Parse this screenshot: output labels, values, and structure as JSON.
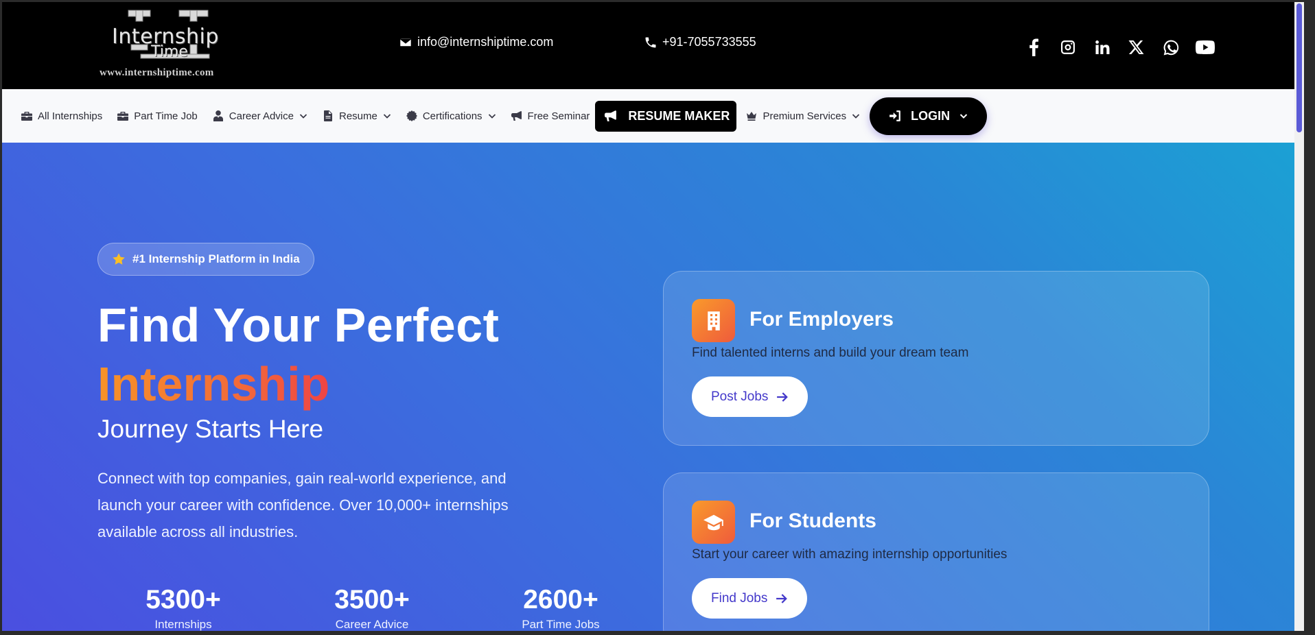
{
  "header": {
    "logo_text_1": "Internship",
    "logo_text_2": "Time",
    "logo_url": "www.internshiptime.com",
    "email": "info@internshiptime.com",
    "phone": "+91-7055733555",
    "socials": [
      "facebook-icon",
      "instagram-icon",
      "linkedin-icon",
      "x-icon",
      "whatsapp-icon",
      "youtube-icon"
    ]
  },
  "nav": {
    "items": [
      {
        "label": "All Internships",
        "icon": "briefcase-icon",
        "dropdown": false
      },
      {
        "label": "Part Time Job",
        "icon": "briefcase-icon",
        "dropdown": false
      },
      {
        "label": "Career Advice",
        "icon": "user-tie-icon",
        "dropdown": true
      },
      {
        "label": "Resume",
        "icon": "file-icon",
        "dropdown": true
      },
      {
        "label": "Certifications",
        "icon": "certificate-icon",
        "dropdown": true
      },
      {
        "label": "Free Seminar",
        "icon": "bullhorn-icon",
        "dropdown": false
      }
    ],
    "resume_maker": "RESUME MAKER",
    "premium": "Premium Services",
    "login": "LOGIN"
  },
  "hero": {
    "badge": "#1 Internship Platform in India",
    "title_line1": "Find Your Perfect",
    "title_accent": "Internship",
    "subtitle": "Journey Starts Here",
    "lead": "Connect with top companies, gain real-world experience, and launch your career with confidence. Over 10,000+ internships available across all industries.",
    "stats": [
      {
        "value": "5300+",
        "label": "Internships"
      },
      {
        "value": "3500+",
        "label": "Career Advice"
      },
      {
        "value": "2600+",
        "label": "Part Time Jobs"
      }
    ]
  },
  "cards": {
    "employers": {
      "title": "For Employers",
      "desc": "Find talented interns and build your dream team",
      "button": "Post Jobs"
    },
    "students": {
      "title": "For Students",
      "desc": "Start your career with amazing internship opportunities",
      "button": "Find Jobs"
    }
  },
  "colors": {
    "brand_accent": "#f26b3a",
    "nav_bg": "#f8f9fb",
    "hero_start": "#4a4fe0",
    "hero_end": "#1ba1d4"
  }
}
